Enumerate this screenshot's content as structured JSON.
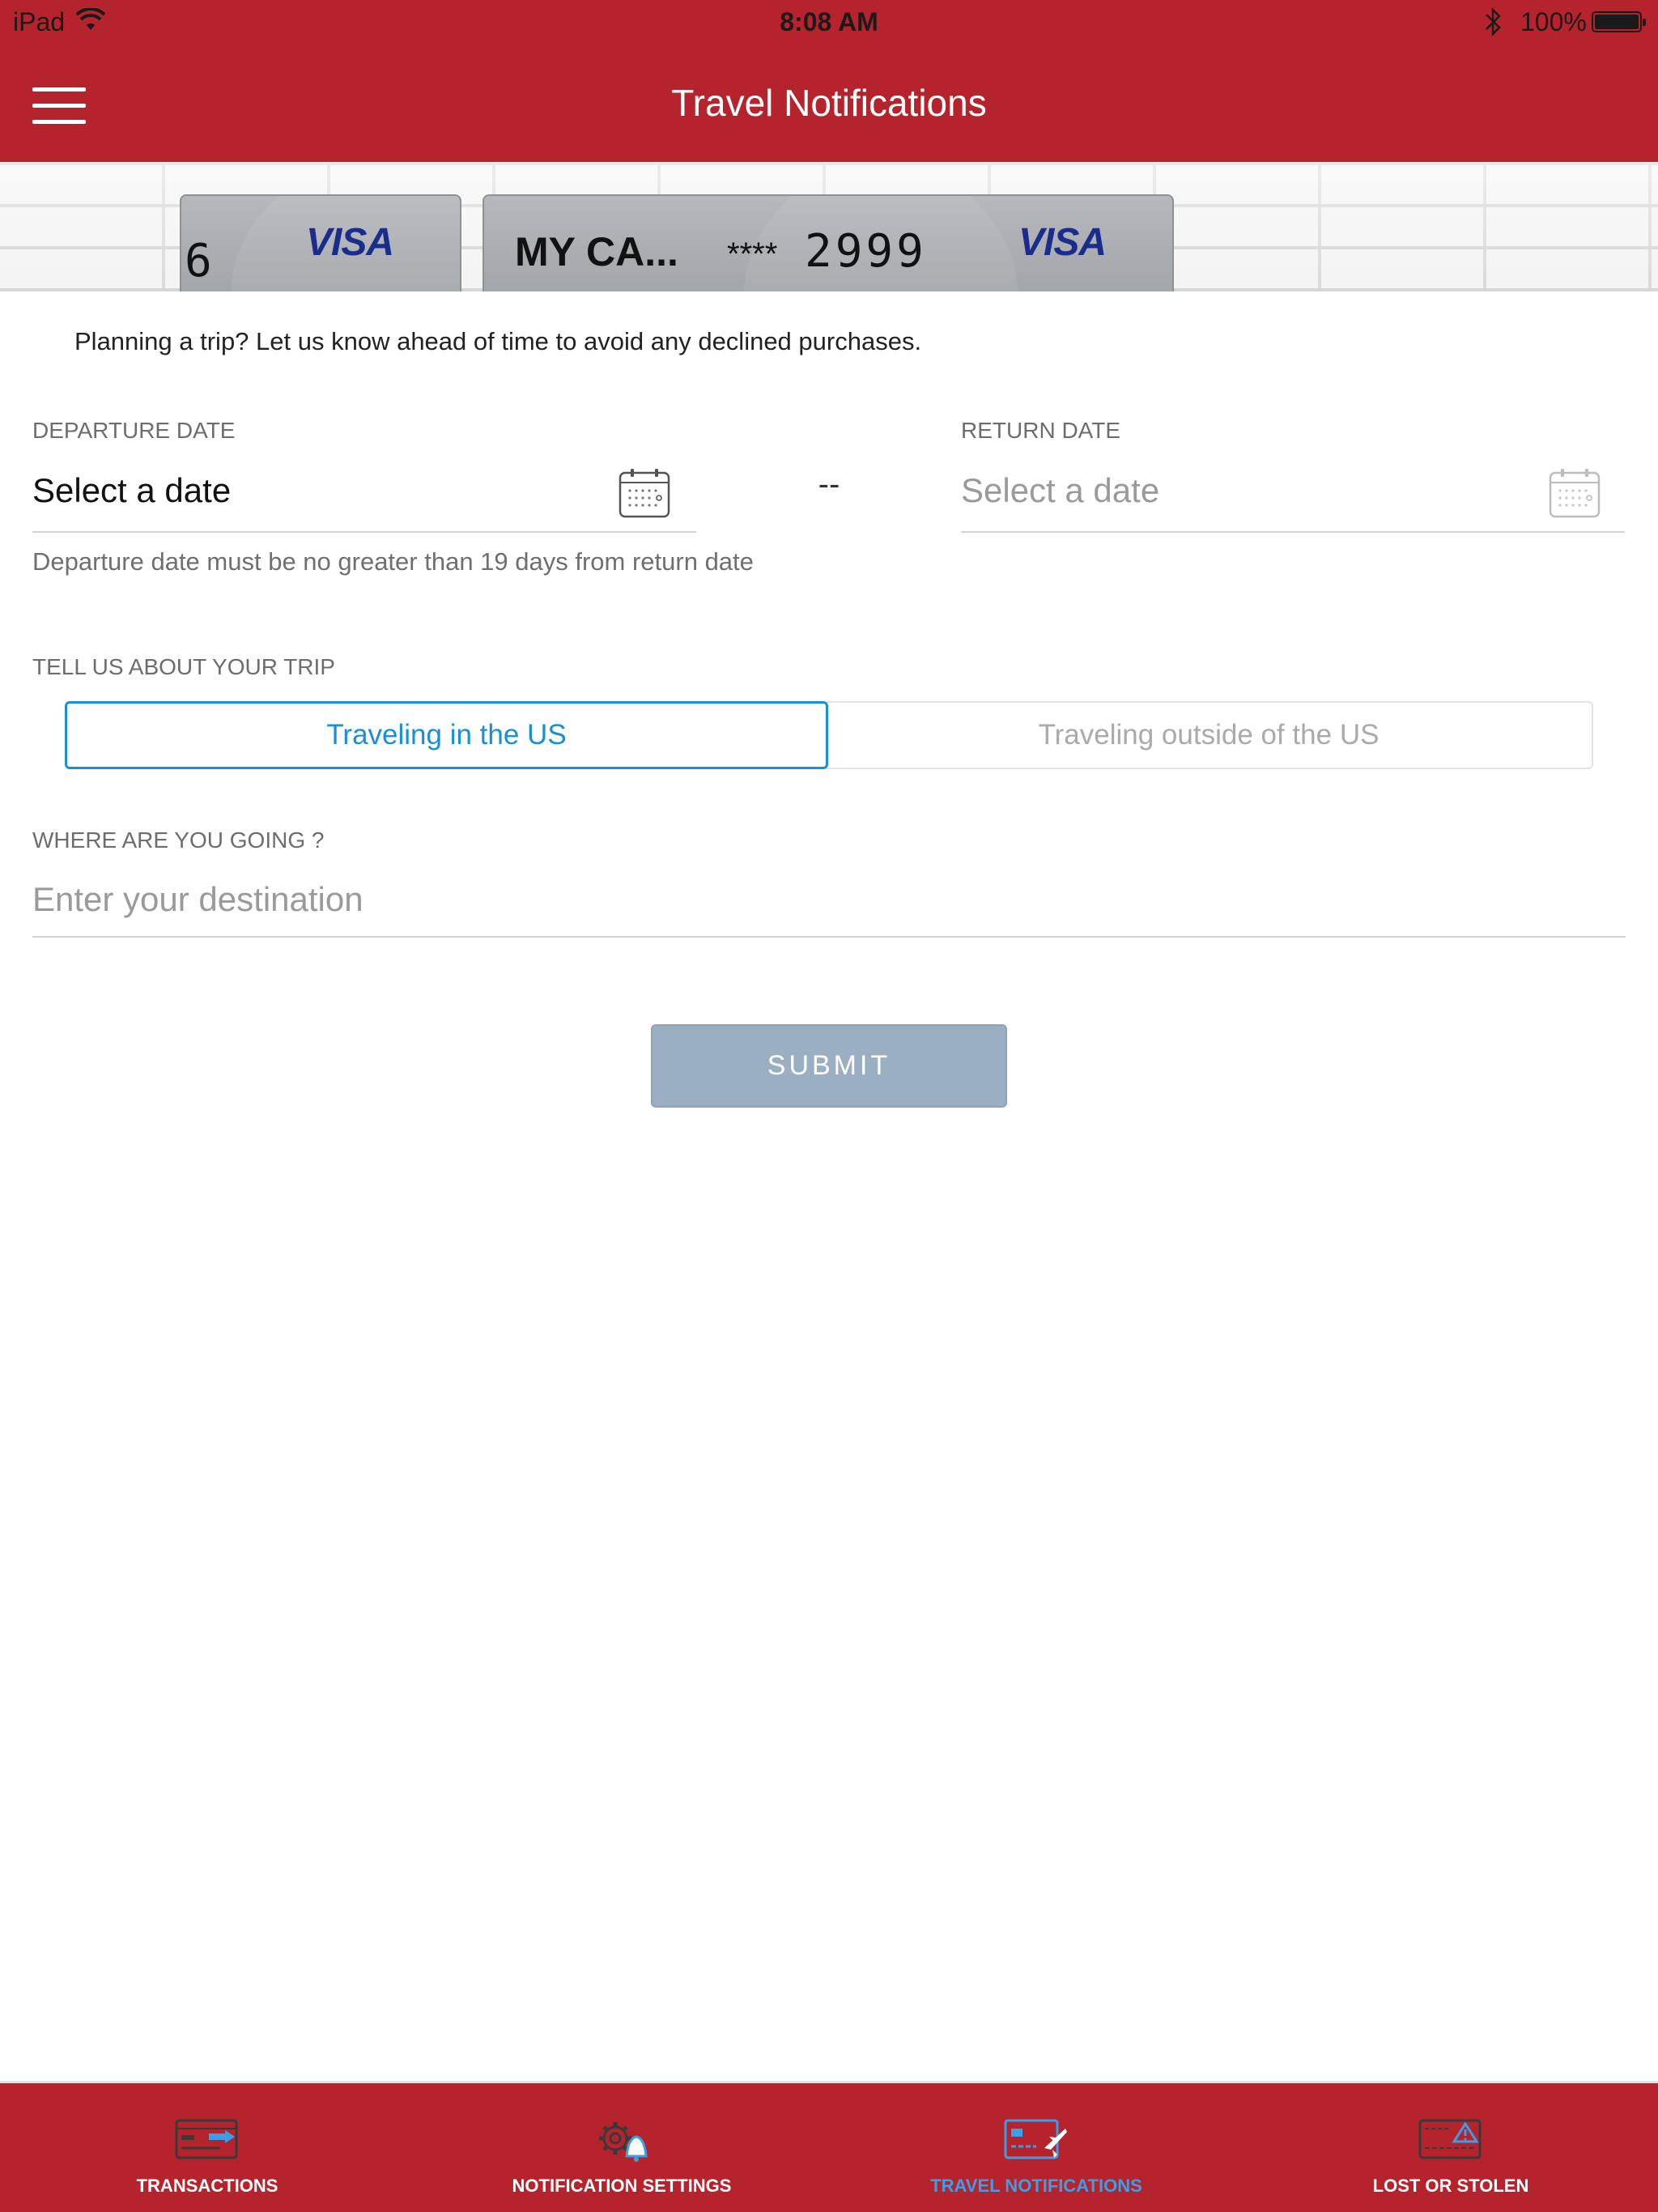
{
  "status_bar": {
    "carrier": "iPad",
    "time": "8:08 AM",
    "battery": "100%"
  },
  "header": {
    "title": "Travel Notifications"
  },
  "cards": [
    {
      "number_fragment": "6",
      "brand": "VISA"
    },
    {
      "name": "MY CA...",
      "masked": "****",
      "last4": "2999",
      "brand": "VISA"
    }
  ],
  "intro": "Planning a trip? Let us know ahead of time to avoid any declined purchases.",
  "departure": {
    "label": "DEPARTURE DATE",
    "value": "Select a date"
  },
  "separator": "--",
  "return": {
    "label": "RETURN DATE",
    "value": "Select a date"
  },
  "hint": "Departure date must be no greater than 19 days from return date",
  "trip": {
    "label": "TELL US ABOUT YOUR TRIP",
    "options": [
      "Traveling in the US",
      "Traveling outside of the US"
    ],
    "selected": "Traveling in the US"
  },
  "destination": {
    "label": "WHERE ARE YOU GOING ?",
    "placeholder": "Enter your destination",
    "value": ""
  },
  "submit_label": "SUBMIT",
  "tabs": [
    {
      "label": "TRANSACTIONS",
      "icon": "transactions-card-icon"
    },
    {
      "label": "NOTIFICATION SETTINGS",
      "icon": "gear-bell-icon"
    },
    {
      "label": "TRAVEL NOTIFICATIONS",
      "icon": "card-plane-icon",
      "active": true
    },
    {
      "label": "LOST OR STOLEN",
      "icon": "card-warning-icon"
    }
  ],
  "colors": {
    "brand_red": "#b5242c",
    "accent_blue": "#1a8fd8",
    "submit_disabled": "#9bafc2",
    "visa_blue": "#1a2c8c"
  }
}
